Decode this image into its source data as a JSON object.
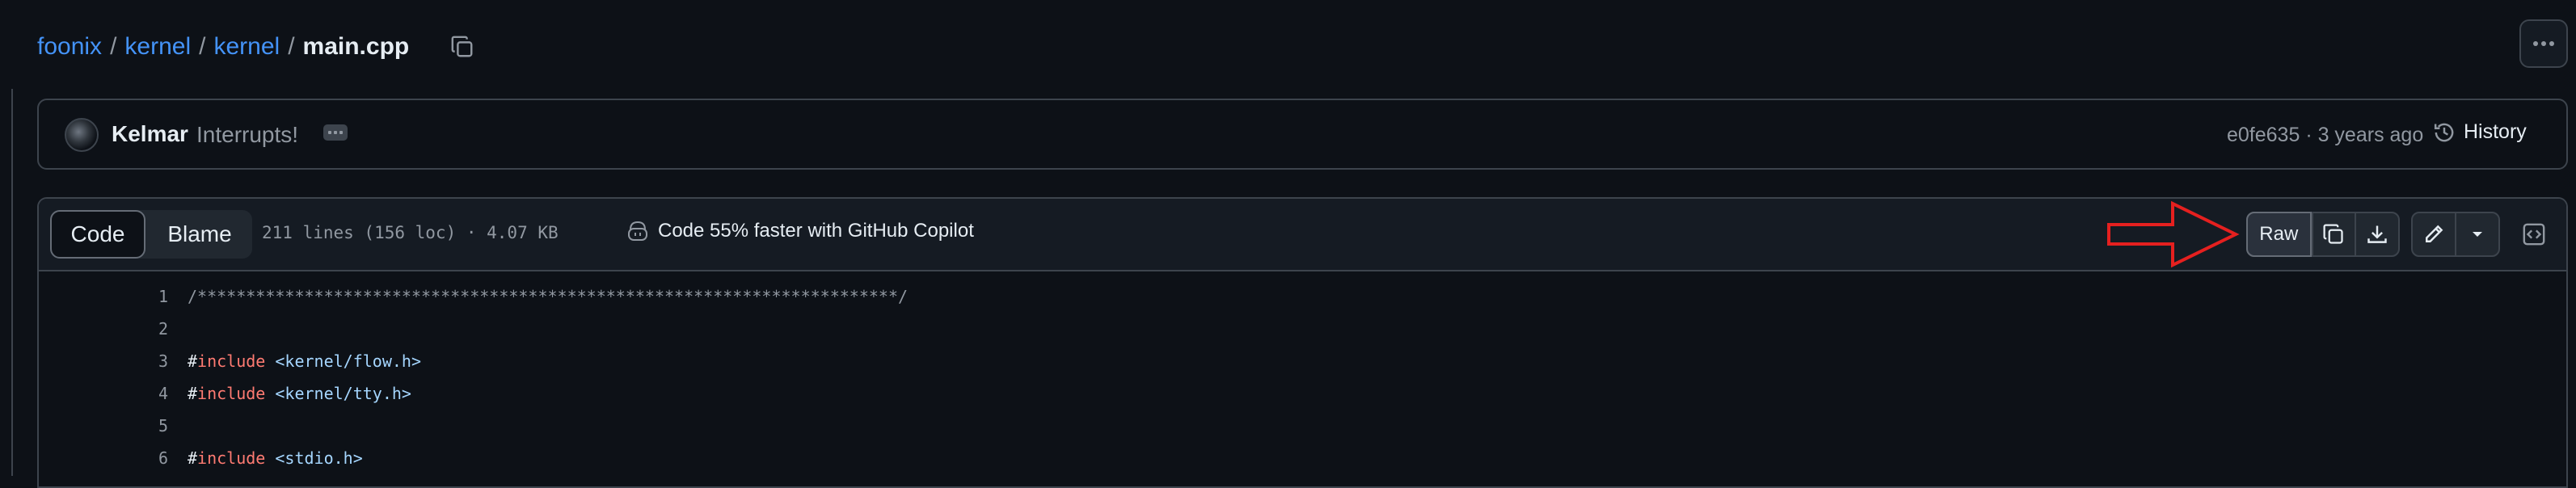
{
  "breadcrumb": {
    "items": [
      "foonix",
      "kernel",
      "kernel"
    ],
    "separator": "/",
    "file": "main.cpp"
  },
  "commit": {
    "author": "Kelmar",
    "message": "Interrupts!",
    "meta": "e0fe635 · 3 years ago",
    "history_label": "History"
  },
  "file_header": {
    "tabs": [
      "Code",
      "Blame"
    ],
    "active_tab": "Code",
    "info": "211 lines (156 loc) · 4.07 KB",
    "copilot": "Code 55% faster with GitHub Copilot",
    "raw_label": "Raw"
  },
  "code": [
    {
      "num": "1",
      "tokens": [
        {
          "t": "/************************************************************************/",
          "c": "cmt"
        }
      ]
    },
    {
      "num": "2",
      "tokens": []
    },
    {
      "num": "3",
      "tokens": [
        {
          "t": "#",
          "c": "plain"
        },
        {
          "t": "include",
          "c": "kw"
        },
        {
          "t": " <kernel/flow.h>",
          "c": "str"
        }
      ]
    },
    {
      "num": "4",
      "tokens": [
        {
          "t": "#",
          "c": "plain"
        },
        {
          "t": "include",
          "c": "kw"
        },
        {
          "t": " <kernel/tty.h>",
          "c": "str"
        }
      ]
    },
    {
      "num": "5",
      "tokens": []
    },
    {
      "num": "6",
      "tokens": [
        {
          "t": "#",
          "c": "plain"
        },
        {
          "t": "include",
          "c": "kw"
        },
        {
          "t": " <stdio.h>",
          "c": "str"
        }
      ]
    }
  ],
  "colors": {
    "background": "#0d1117",
    "link": "#4493f8",
    "border": "#3d444d",
    "annotation_arrow": "#e5201f"
  }
}
